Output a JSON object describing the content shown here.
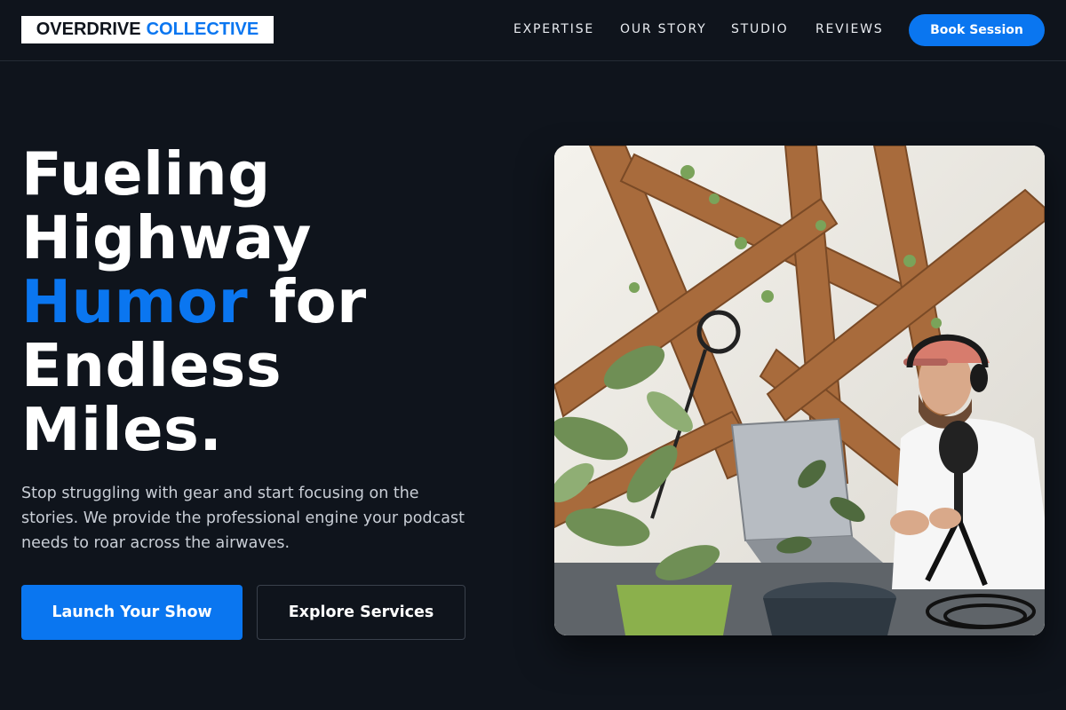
{
  "brand": {
    "name_main": "OVERDRIVE",
    "name_accent": "COLLECTIVE"
  },
  "nav": {
    "links": [
      "EXPERTISE",
      "OUR STORY",
      "STUDIO",
      "REVIEWS"
    ],
    "cta_label": "Book Session"
  },
  "hero": {
    "headline_line1": "Fueling",
    "headline_line2": "Highway",
    "headline_accent": "Humor",
    "headline_line3_rest": " for",
    "headline_line4": "Endless",
    "headline_line5": "Miles.",
    "subtext": "Stop struggling with gear and start focusing on the stories. We provide the professional engine your podcast needs to roar across the airwaves.",
    "primary_cta": "Launch Your Show",
    "secondary_cta": "Explore Services",
    "image_alt": "podcast-host-in-studio-photo"
  },
  "colors": {
    "background": "#0f141c",
    "accent": "#0a76f0",
    "text": "#ffffff",
    "muted_text": "#c9ced6"
  }
}
